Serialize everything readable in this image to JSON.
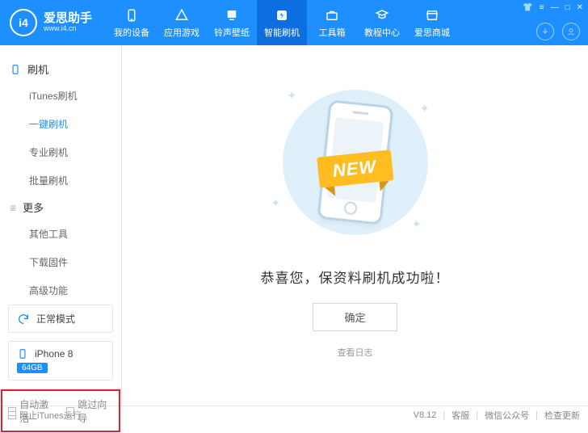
{
  "app": {
    "name": "爱思助手",
    "url": "www.i4.cn",
    "logo_badge": "i4"
  },
  "nav": [
    {
      "label": "我的设备",
      "icon": "device"
    },
    {
      "label": "应用游戏",
      "icon": "apps"
    },
    {
      "label": "铃声壁纸",
      "icon": "ringtone"
    },
    {
      "label": "智能刷机",
      "icon": "flash",
      "active": true
    },
    {
      "label": "工具箱",
      "icon": "tools"
    },
    {
      "label": "教程中心",
      "icon": "tutorial"
    },
    {
      "label": "爱思商城",
      "icon": "shop"
    }
  ],
  "sidebar": {
    "groups": [
      {
        "title": "刷机",
        "items": [
          {
            "label": "iTunes刷机"
          },
          {
            "label": "一键刷机",
            "active": true
          },
          {
            "label": "专业刷机"
          },
          {
            "label": "批量刷机"
          }
        ]
      },
      {
        "title": "更多",
        "items": [
          {
            "label": "其他工具"
          },
          {
            "label": "下载固件"
          },
          {
            "label": "高级功能"
          }
        ]
      }
    ],
    "mode": "正常模式",
    "device": {
      "name": "iPhone 8",
      "storage": "64GB"
    },
    "options": [
      {
        "label": "自动激活"
      },
      {
        "label": "跳过向导"
      }
    ]
  },
  "main": {
    "ribbon": "NEW",
    "title": "恭喜您，保资料刷机成功啦！",
    "confirm": "确定",
    "log": "查看日志"
  },
  "footer": {
    "block_itunes": "阻止iTunes运行",
    "version": "V8.12",
    "links": [
      "客服",
      "微信公众号",
      "检查更新"
    ]
  }
}
